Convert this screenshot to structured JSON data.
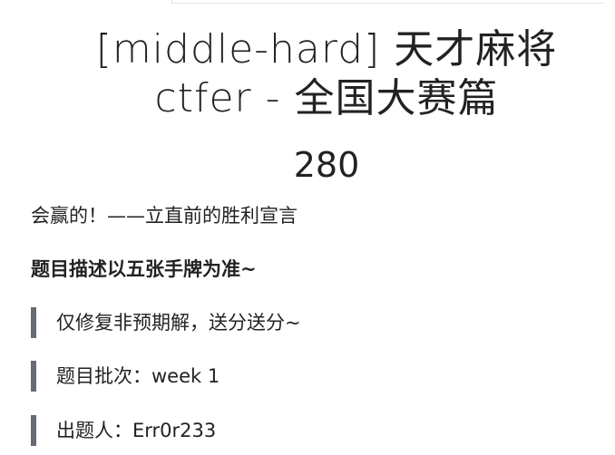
{
  "challenge": {
    "title_line1": "[middle-hard] 天才麻将",
    "title_line2": "ctfer - 全国大赛篇",
    "value": "280"
  },
  "description": {
    "tagline": "会赢的！——立直前的胜利宣言",
    "bold_note": "题目描述以五张手牌为准~",
    "quotes": [
      "仅修复非预期解，送分送分~",
      "题目批次：week 1",
      "出题人：Err0r233"
    ]
  }
}
